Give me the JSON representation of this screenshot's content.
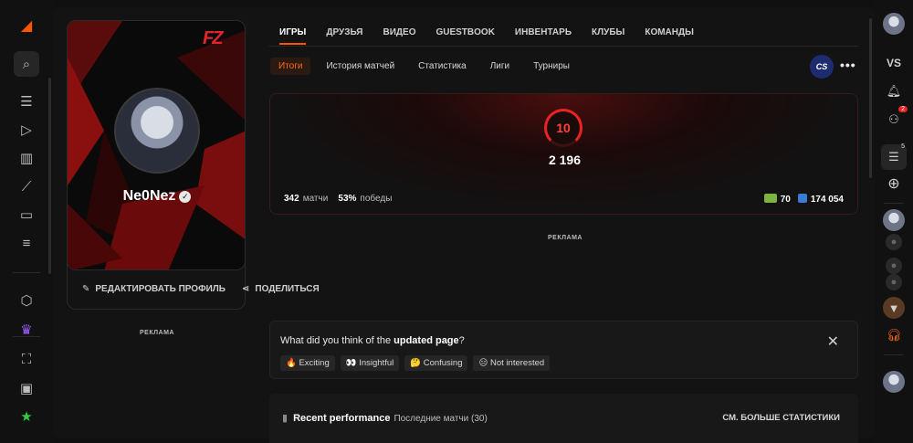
{
  "colors": {
    "accent": "#ff5500",
    "level": "#e22222",
    "bg": "#101010"
  },
  "left_rail": {
    "items": [
      {
        "name": "logo-icon",
        "glyph": "◢"
      },
      {
        "name": "search-icon",
        "glyph": "⌕"
      },
      {
        "name": "find-players-icon",
        "glyph": "☰"
      },
      {
        "name": "play-icon",
        "glyph": "▷"
      },
      {
        "name": "leaderboard-icon",
        "glyph": "▥"
      },
      {
        "name": "stats-icon",
        "glyph": "⟋"
      },
      {
        "name": "video-icon",
        "glyph": "▭"
      },
      {
        "name": "list-icon",
        "glyph": "≡"
      },
      {
        "name": "hub-icon",
        "glyph": "⬡"
      },
      {
        "name": "purple-icon",
        "glyph": "♛"
      },
      {
        "name": "scan-icon",
        "glyph": "⛶"
      },
      {
        "name": "briefcase-icon",
        "glyph": "▣"
      },
      {
        "name": "star-icon",
        "glyph": "★"
      }
    ]
  },
  "profile": {
    "team_logo": "FZ",
    "nickname": "Ne0Nez",
    "verified": "✓",
    "edit_label": "РЕДАКТИРОВАТЬ ПРОФИЛЬ",
    "share_label": "ПОДЕЛИТЬСЯ",
    "ad_label": "РЕКЛАМА"
  },
  "tabs": [
    "ИГРЫ",
    "ДРУЗЬЯ",
    "ВИДЕО",
    "GUESTBOOK",
    "ИНВЕНТАРЬ",
    "КЛУБЫ",
    "КОМАНДЫ"
  ],
  "subtabs": [
    "Итоги",
    "История матчей",
    "Статистика",
    "Лиги",
    "Турниры"
  ],
  "game_badge": "CS",
  "more": "•••",
  "stats": {
    "level": "10",
    "elo": "2 196",
    "matches_value": "342",
    "matches_label": "матчи",
    "winrate_value": "53%",
    "winrate_label": "победы",
    "points_a": "70",
    "points_b": "174 054"
  },
  "ad_mid": "РЕКЛАМА",
  "feedback": {
    "question_prefix": "What did you think of the ",
    "question_bold": "updated page",
    "question_suffix": "?",
    "close": "✕",
    "options": [
      "🔥 Exciting",
      "👀 Insightful",
      "🤔 Confusing",
      "😑 Not interested"
    ]
  },
  "recent": {
    "title": "Recent performance",
    "subtitle": "Последние матчи (30)",
    "more_label": "СМ. БОЛЬШЕ СТАТИСТИКИ"
  },
  "right_rail": {
    "vs": "VS",
    "friend_requests_badge": "2",
    "party_badge": "5"
  }
}
